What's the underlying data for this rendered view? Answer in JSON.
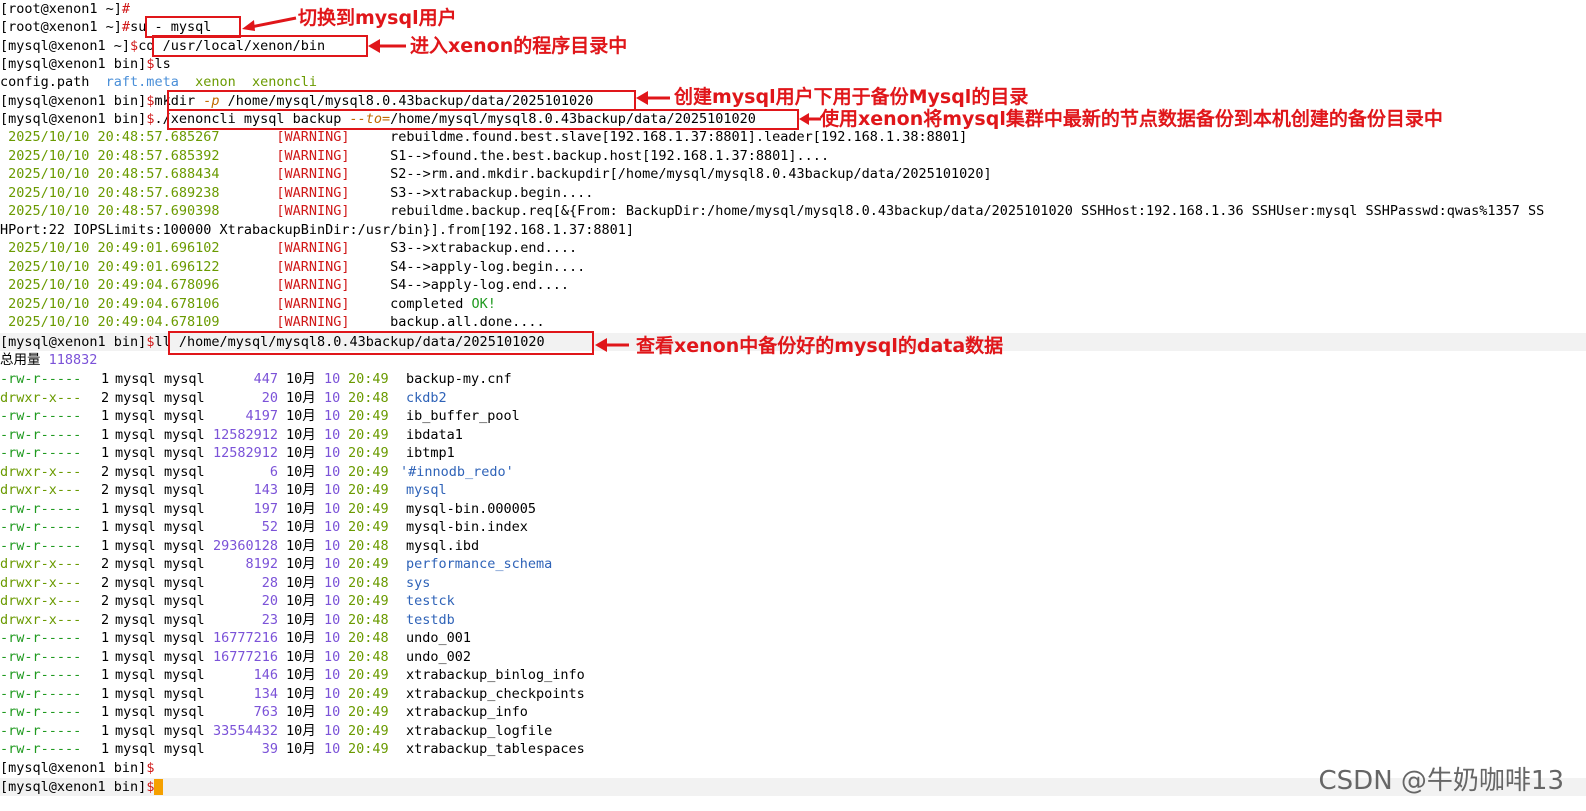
{
  "lines": {
    "l0": {
      "prompt": "[root@xenon1 ~]",
      "cmd": ""
    },
    "l1": {
      "prompt": "[root@xenon1 ~]",
      "cmd": "su - mysql"
    },
    "l2": {
      "prompt": "[mysql@xenon1 ~]",
      "cmd": "cd /usr/local/xenon/bin"
    },
    "l3": {
      "prompt": "[mysql@xenon1 bin]",
      "cmd": "ls"
    },
    "l4": {
      "f1": "config.path",
      "f2": "raft.meta",
      "f3": "xenon",
      "f4": "xenoncli"
    },
    "l5": {
      "prompt": "[mysql@xenon1 bin]",
      "cmd": "mkdir",
      "opt": "-p",
      "arg": "/home/mysql/mysql8.0.43backup/data/2025101020"
    },
    "l6": {
      "prompt": "[mysql@xenon1 bin]",
      "cmd": "./xenoncli mysql backup ",
      "opt": "--to=",
      "arg": "/home/mysql/mysql8.0.43backup/data/2025101020"
    },
    "l7": {
      "ts": "2025/10/10 20:48:57.685267",
      "lv": "[WARNING]",
      "msg": "rebuildme.found.best.slave[192.168.1.37:8801].leader[192.168.1.38:8801]"
    },
    "l8": {
      "ts": "2025/10/10 20:48:57.685392",
      "lv": "[WARNING]",
      "msg": "S1-->found.the.best.backup.host[192.168.1.37:8801]...."
    },
    "l9": {
      "ts": "2025/10/10 20:48:57.688434",
      "lv": "[WARNING]",
      "msg": "S2-->rm.and.mkdir.backupdir[/home/mysql/mysql8.0.43backup/data/2025101020]"
    },
    "l10": {
      "ts": "2025/10/10 20:48:57.689238",
      "lv": "[WARNING]",
      "msg": "S3-->xtrabackup.begin...."
    },
    "l11": {
      "ts": "2025/10/10 20:48:57.690398",
      "lv": "[WARNING]",
      "msg": "rebuildme.backup.req[&{From: BackupDir:/home/mysql/mysql8.0.43backup/data/2025101020 SSHHost:192.168.1.36 SSHUser:mysql SSHPasswd:qwas%1357 SS"
    },
    "l12": {
      "msg": "HPort:22 IOPSLimits:100000 XtrabackupBinDir:/usr/bin}].from[192.168.1.37:8801]"
    },
    "l13": {
      "ts": "2025/10/10 20:49:01.696102",
      "lv": "[WARNING]",
      "msg": "S3-->xtrabackup.end...."
    },
    "l14": {
      "ts": "2025/10/10 20:49:01.696122",
      "lv": "[WARNING]",
      "msg": "S4-->apply-log.begin...."
    },
    "l15": {
      "ts": "2025/10/10 20:49:04.678096",
      "lv": "[WARNING]",
      "msg": "S4-->apply-log.end...."
    },
    "l16": {
      "ts": "2025/10/10 20:49:04.678106",
      "lv": "[WARNING]",
      "msg": "completed OK!"
    },
    "l17": {
      "ts": "2025/10/10 20:49:04.678109",
      "lv": "[WARNING]",
      "msg": "backup.all.done...."
    },
    "l18": {
      "prompt": "[mysql@xenon1 bin]",
      "cmd": "ll /home/mysql/mysql8.0.43backup/data/2025101020"
    },
    "l19": {
      "label": "总用量",
      "value": "118832"
    }
  },
  "files": [
    {
      "perm": "-rw-r-----",
      "links": "1",
      "owner": "mysql",
      "group": "mysql",
      "size": "447",
      "month": "10月",
      "day": "10",
      "time": "20:49",
      "name": "backup-my.cnf",
      "dir": false
    },
    {
      "perm": "drwxr-x---",
      "links": "2",
      "owner": "mysql",
      "group": "mysql",
      "size": "20",
      "month": "10月",
      "day": "10",
      "time": "20:48",
      "name": "ckdb2",
      "dir": true
    },
    {
      "perm": "-rw-r-----",
      "links": "1",
      "owner": "mysql",
      "group": "mysql",
      "size": "4197",
      "month": "10月",
      "day": "10",
      "time": "20:49",
      "name": "ib_buffer_pool",
      "dir": false
    },
    {
      "perm": "-rw-r-----",
      "links": "1",
      "owner": "mysql",
      "group": "mysql",
      "size": "12582912",
      "month": "10月",
      "day": "10",
      "time": "20:49",
      "name": "ibdata1",
      "dir": false
    },
    {
      "perm": "-rw-r-----",
      "links": "1",
      "owner": "mysql",
      "group": "mysql",
      "size": "12582912",
      "month": "10月",
      "day": "10",
      "time": "20:49",
      "name": "ibtmp1",
      "dir": false
    },
    {
      "perm": "drwxr-x---",
      "links": "2",
      "owner": "mysql",
      "group": "mysql",
      "size": "6",
      "month": "10月",
      "day": "10",
      "time": "20:49",
      "name": "'#innodb_redo'",
      "dir": true
    },
    {
      "perm": "drwxr-x---",
      "links": "2",
      "owner": "mysql",
      "group": "mysql",
      "size": "143",
      "month": "10月",
      "day": "10",
      "time": "20:49",
      "name": "mysql",
      "dir": true
    },
    {
      "perm": "-rw-r-----",
      "links": "1",
      "owner": "mysql",
      "group": "mysql",
      "size": "197",
      "month": "10月",
      "day": "10",
      "time": "20:49",
      "name": "mysql-bin.000005",
      "dir": false
    },
    {
      "perm": "-rw-r-----",
      "links": "1",
      "owner": "mysql",
      "group": "mysql",
      "size": "52",
      "month": "10月",
      "day": "10",
      "time": "20:49",
      "name": "mysql-bin.index",
      "dir": false
    },
    {
      "perm": "-rw-r-----",
      "links": "1",
      "owner": "mysql",
      "group": "mysql",
      "size": "29360128",
      "month": "10月",
      "day": "10",
      "time": "20:48",
      "name": "mysql.ibd",
      "dir": false
    },
    {
      "perm": "drwxr-x---",
      "links": "2",
      "owner": "mysql",
      "group": "mysql",
      "size": "8192",
      "month": "10月",
      "day": "10",
      "time": "20:49",
      "name": "performance_schema",
      "dir": true
    },
    {
      "perm": "drwxr-x---",
      "links": "2",
      "owner": "mysql",
      "group": "mysql",
      "size": "28",
      "month": "10月",
      "day": "10",
      "time": "20:48",
      "name": "sys",
      "dir": true
    },
    {
      "perm": "drwxr-x---",
      "links": "2",
      "owner": "mysql",
      "group": "mysql",
      "size": "20",
      "month": "10月",
      "day": "10",
      "time": "20:49",
      "name": "testck",
      "dir": true
    },
    {
      "perm": "drwxr-x---",
      "links": "2",
      "owner": "mysql",
      "group": "mysql",
      "size": "23",
      "month": "10月",
      "day": "10",
      "time": "20:48",
      "name": "testdb",
      "dir": true
    },
    {
      "perm": "-rw-r-----",
      "links": "1",
      "owner": "mysql",
      "group": "mysql",
      "size": "16777216",
      "month": "10月",
      "day": "10",
      "time": "20:48",
      "name": "undo_001",
      "dir": false
    },
    {
      "perm": "-rw-r-----",
      "links": "1",
      "owner": "mysql",
      "group": "mysql",
      "size": "16777216",
      "month": "10月",
      "day": "10",
      "time": "20:48",
      "name": "undo_002",
      "dir": false
    },
    {
      "perm": "-rw-r-----",
      "links": "1",
      "owner": "mysql",
      "group": "mysql",
      "size": "146",
      "month": "10月",
      "day": "10",
      "time": "20:49",
      "name": "xtrabackup_binlog_info",
      "dir": false
    },
    {
      "perm": "-rw-r-----",
      "links": "1",
      "owner": "mysql",
      "group": "mysql",
      "size": "134",
      "month": "10月",
      "day": "10",
      "time": "20:49",
      "name": "xtrabackup_checkpoints",
      "dir": false
    },
    {
      "perm": "-rw-r-----",
      "links": "1",
      "owner": "mysql",
      "group": "mysql",
      "size": "763",
      "month": "10月",
      "day": "10",
      "time": "20:49",
      "name": "xtrabackup_info",
      "dir": false
    },
    {
      "perm": "-rw-r-----",
      "links": "1",
      "owner": "mysql",
      "group": "mysql",
      "size": "33554432",
      "month": "10月",
      "day": "10",
      "time": "20:49",
      "name": "xtrabackup_logfile",
      "dir": false
    },
    {
      "perm": "-rw-r-----",
      "links": "1",
      "owner": "mysql",
      "group": "mysql",
      "size": "39",
      "month": "10月",
      "day": "10",
      "time": "20:49",
      "name": "xtrabackup_tablespaces",
      "dir": false
    }
  ],
  "end_prompts": {
    "p1": "[mysql@xenon1 bin]",
    "p2": "[mysql@xenon1 bin]"
  },
  "sep_char": "$",
  "root_sep_char": "#",
  "annotations": {
    "a1": "切换到mysql用户",
    "a2": "进入xenon的程序目录中",
    "a3": "创建mysql用户下用于备份Mysql的目录",
    "a4": "使用xenon将mysql集群中最新的节点数据备份到本机创建的备份目录中",
    "a5": "查看xenon中备份好的mysql的data数据"
  },
  "watermark": "CSDN @牛奶咖啡13",
  "colors": {
    "annotation": "#e0161a",
    "cursor": "#f5a000",
    "warning": "#d01818",
    "directory": "#2f63b8"
  }
}
